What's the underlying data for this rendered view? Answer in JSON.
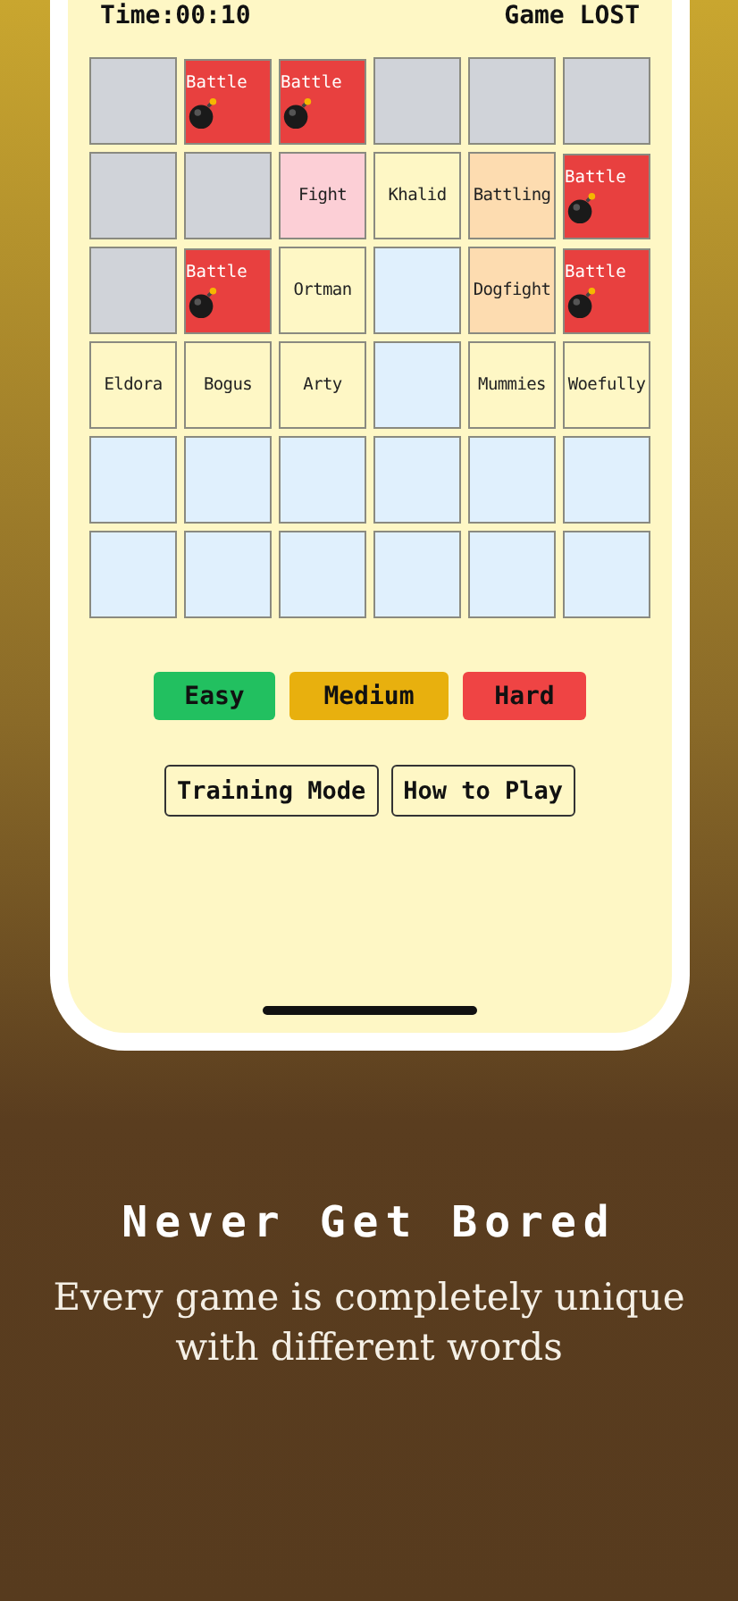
{
  "status": {
    "time": "Time:00:10",
    "result": "Game LOST"
  },
  "grid": [
    [
      {
        "kind": "hidden"
      },
      {
        "kind": "bomb",
        "word": "Battle"
      },
      {
        "kind": "bomb",
        "word": "Battle"
      },
      {
        "kind": "hidden"
      },
      {
        "kind": "hidden"
      },
      {
        "kind": "hidden"
      }
    ],
    [
      {
        "kind": "hidden"
      },
      {
        "kind": "hidden"
      },
      {
        "kind": "word",
        "word": "Fight",
        "color": "#fccfd6"
      },
      {
        "kind": "word",
        "word": "Khalid",
        "color": "#fef7c5"
      },
      {
        "kind": "word",
        "word": "Battling",
        "color": "#fddcb0"
      },
      {
        "kind": "bomb",
        "word": "Battle"
      }
    ],
    [
      {
        "kind": "hidden"
      },
      {
        "kind": "bomb",
        "word": "Battle"
      },
      {
        "kind": "word",
        "word": "Ortman",
        "color": "#fef7c5"
      },
      {
        "kind": "empty"
      },
      {
        "kind": "word",
        "word": "Dogfight",
        "color": "#fddcb0"
      },
      {
        "kind": "bomb",
        "word": "Battle"
      }
    ],
    [
      {
        "kind": "word",
        "word": "Eldora",
        "color": "#fef7c5"
      },
      {
        "kind": "word",
        "word": "Bogus",
        "color": "#fef7c5"
      },
      {
        "kind": "word",
        "word": "Arty",
        "color": "#fef7c5"
      },
      {
        "kind": "empty"
      },
      {
        "kind": "word",
        "word": "Mummies",
        "color": "#fef7c5"
      },
      {
        "kind": "word",
        "word": "Woefully",
        "color": "#fef7c5"
      }
    ],
    [
      {
        "kind": "empty"
      },
      {
        "kind": "empty"
      },
      {
        "kind": "empty"
      },
      {
        "kind": "empty"
      },
      {
        "kind": "empty"
      },
      {
        "kind": "empty"
      }
    ],
    [
      {
        "kind": "empty"
      },
      {
        "kind": "empty"
      },
      {
        "kind": "empty"
      },
      {
        "kind": "empty"
      },
      {
        "kind": "empty"
      },
      {
        "kind": "empty"
      }
    ]
  ],
  "difficulties": [
    {
      "label": "Easy",
      "color": "#22c060"
    },
    {
      "label": "Medium",
      "color": "#e8b00e"
    },
    {
      "label": "Hard",
      "color": "#ef4444"
    }
  ],
  "buttons": [
    "Training Mode",
    "How to Play"
  ],
  "caption": {
    "title": "Never Get Bored",
    "text": "Every game is completely unique with different words"
  }
}
